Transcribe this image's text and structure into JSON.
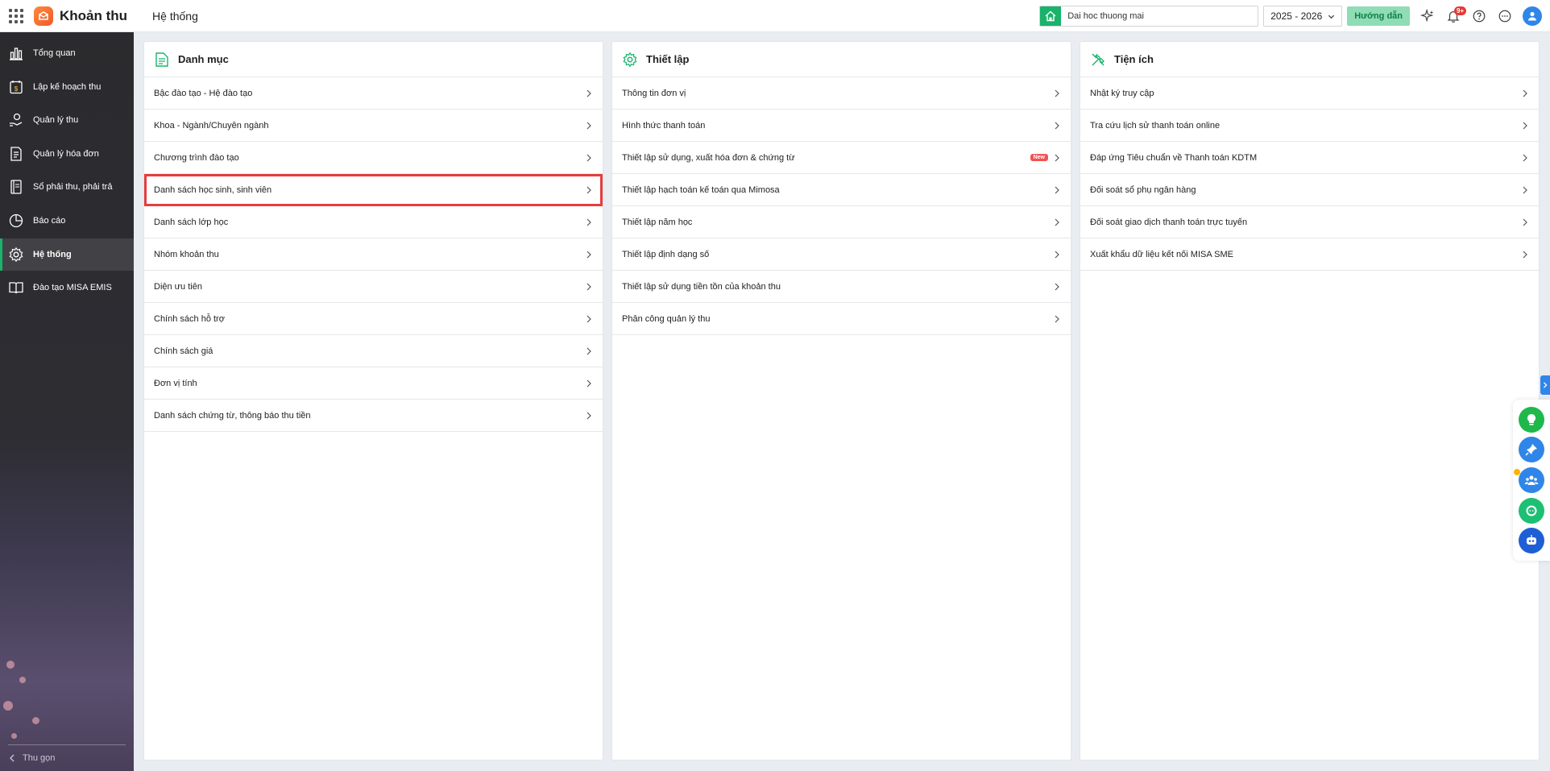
{
  "app": {
    "name": "Khoản thu",
    "page_title": "Hệ thống"
  },
  "topbar": {
    "unit_value": "Dai hoc thuong mai",
    "year": "2025 - 2026",
    "guide_label": "Hướng dẫn",
    "notification_count": "9+"
  },
  "sidebar": {
    "items": [
      {
        "label": "Tổng quan",
        "icon": "chart-icon"
      },
      {
        "label": "Lập kế hoạch thu",
        "icon": "calendar-money-icon"
      },
      {
        "label": "Quản lý thu",
        "icon": "hand-money-icon"
      },
      {
        "label": "Quản lý hóa đơn",
        "icon": "invoice-icon"
      },
      {
        "label": "Sổ phải thu, phải trả",
        "icon": "ledger-icon"
      },
      {
        "label": "Báo cáo",
        "icon": "pie-chart-icon"
      },
      {
        "label": "Hệ thống",
        "icon": "gear-icon",
        "active": true
      },
      {
        "label": "Đào tạo MISA EMIS",
        "icon": "book-icon"
      }
    ],
    "collapse_label": "Thu gọn"
  },
  "panels": [
    {
      "title": "Danh mục",
      "items": [
        "Bậc đào tạo - Hệ đào tạo",
        "Khoa - Ngành/Chuyên ngành",
        "Chương trình đào tạo",
        "Danh sách học sinh, sinh viên",
        "Danh sách lớp học",
        "Nhóm khoản thu",
        "Diện ưu tiên",
        "Chính sách hỗ trợ",
        "Chính sách giá",
        "Đơn vị tính",
        "Danh sách chứng từ, thông báo thu tiền"
      ]
    },
    {
      "title": "Thiết lập",
      "items": [
        "Thông tin đơn vị",
        "Hình thức thanh toán",
        "Thiết lập sử dụng, xuất hóa đơn & chứng từ",
        "Thiết lập hạch toán kế toán qua Mimosa",
        "Thiết lập năm học",
        "Thiết lập định dạng số",
        "Thiết lập sử dụng tiền tồn của khoản thu",
        "Phân công quản lý thu"
      ],
      "new_badge": "New"
    },
    {
      "title": "Tiện ích",
      "items": [
        "Nhật ký truy cập",
        "Tra cứu lịch sử thanh toán online",
        "Đáp ứng Tiêu chuẩn về Thanh toán KDTM",
        "Đối soát sổ phụ ngân hàng",
        "Đối soát giao dịch thanh toán trực tuyến",
        "Xuất khẩu dữ liệu kết nối MISA SME"
      ]
    }
  ],
  "colors": {
    "accent": "#19b36b",
    "highlight": "#e53d3d",
    "brand": "#f0592a"
  }
}
